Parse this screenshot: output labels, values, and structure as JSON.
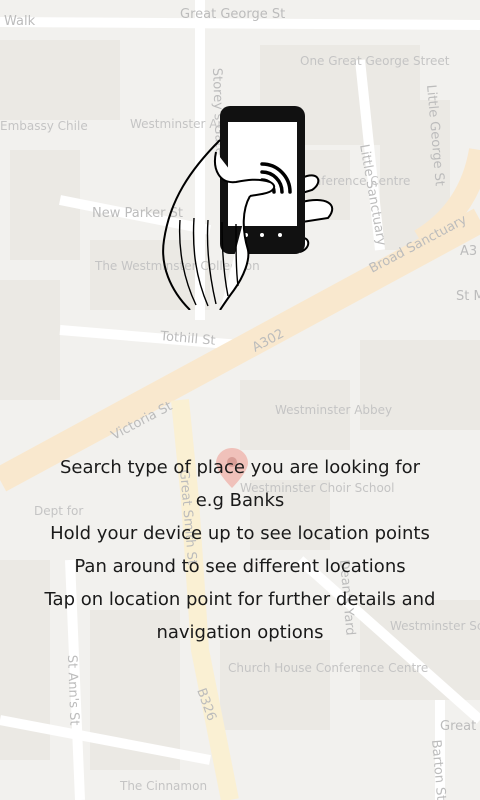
{
  "map": {
    "streets": [
      "Great George St",
      "Walk",
      "Storey's Gate",
      "Little George St",
      "Little Sanctuary",
      "Broad Sanctuary",
      "New Parker St",
      "Tothill St",
      "A302",
      "Victoria St",
      "Great Smith St",
      "Dean's Yard",
      "St Ann's St",
      "B326",
      "Barton St",
      "Great",
      "A3",
      "St M"
    ],
    "places": [
      "One Great George Street",
      "Westminster Arms",
      "Embassy Chile",
      "The Westminster Collection",
      "QEII Conference Centre",
      "Westminster Abbey",
      "Westminster Choir School",
      "Dept for",
      "Westminster School",
      "Church House Conference Centre",
      "The Cinnamon"
    ]
  },
  "instructions": {
    "line1": "Search type of place you are looking for",
    "line2": "e.g Banks",
    "line3": "Hold your device up to see location points",
    "line4": "Pan around to see different locations",
    "line5": "Tap on location point for further details and",
    "line6": "navigation options"
  }
}
